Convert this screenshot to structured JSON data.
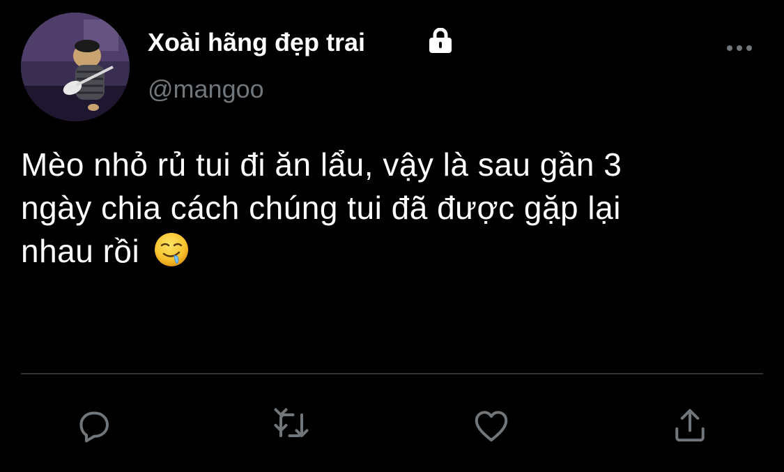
{
  "author": {
    "display_name": "Xoài hãng đẹp trai",
    "handle": "@mangoo",
    "protected_icon": "lock-icon",
    "avatar": "avatar"
  },
  "header": {
    "more_icon": "more-horizontal-icon"
  },
  "tweet": {
    "lines": [
      "Mèo nhỏ rủ tui đi ăn lẩu, vậy là sau gần 3",
      "ngày chia cách chúng tui đã được gặp lại",
      "nhau rồi"
    ],
    "emoji": "🤤"
  },
  "actions": [
    {
      "name": "reply",
      "icon": "reply-icon"
    },
    {
      "name": "retweet",
      "icon": "retweet-icon"
    },
    {
      "name": "like",
      "icon": "heart-icon"
    },
    {
      "name": "share",
      "icon": "share-icon"
    }
  ],
  "colors": {
    "background": "#000000",
    "text_primary": "#ffffff",
    "text_secondary": "#71767b",
    "divider": "#2f3336",
    "icon": "#71767b"
  }
}
